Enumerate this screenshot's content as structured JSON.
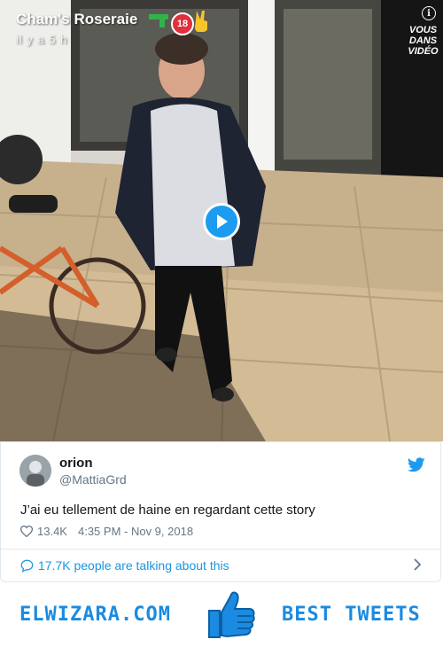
{
  "story": {
    "title": "Cham's Roseraie",
    "time": "il y a 5 h",
    "badge": "18",
    "store_sign": "VOUS DANS VIDÉO"
  },
  "tweet": {
    "display_name": "orion",
    "handle": "@MattiaGrd",
    "text": "J’ai eu tellement de haine en regardant cette story",
    "likes": "13.4K",
    "timestamp": "4:35 PM - Nov 9, 2018",
    "talking": "17.7K people are talking about this"
  },
  "banner": {
    "left": "ELWIZARA.COM",
    "right": "BEST TWEETS"
  },
  "colors": {
    "twitter_blue": "#1d9bf0",
    "link_blue": "#1b95e0",
    "banner_blue": "#1a8be0",
    "muted": "#657786"
  },
  "icons": [
    "info-icon",
    "play-icon",
    "twitter-bird-icon",
    "heart-icon",
    "comment-icon",
    "chevron-right-icon",
    "thumbs-up-icon"
  ]
}
